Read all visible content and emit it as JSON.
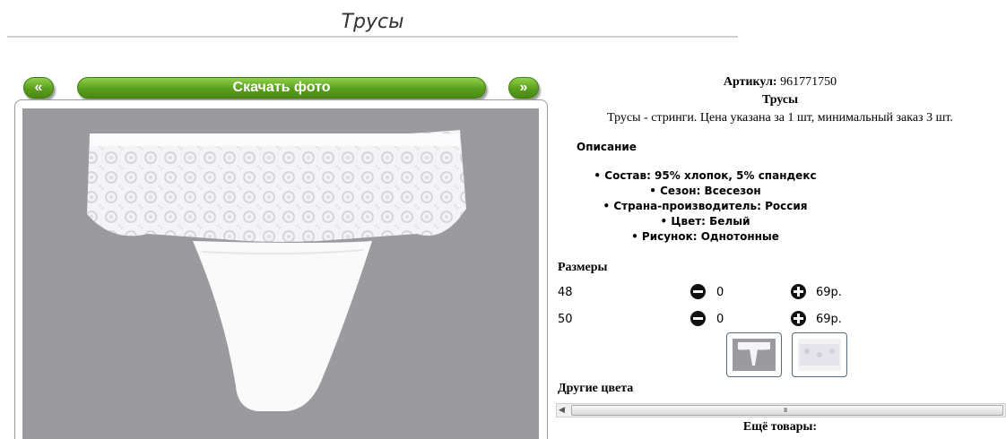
{
  "page": {
    "title": "Трусы"
  },
  "gallery": {
    "prev_label": "«",
    "next_label": "»",
    "download_label": "Скачать фото"
  },
  "product": {
    "article_label": "Артикул:",
    "article_value": "961771750",
    "name": "Трусы",
    "short_description": "Трусы - стринги. Цена указана за 1 шт, минимальный заказ 3 шт.",
    "description_heading": "Описание",
    "properties": [
      "Состав: 95% хлопок, 5% спандекс",
      "Сезон: Всесезон",
      "Страна-производитель: Россия",
      "Цвет: Белый",
      "Рисунок: Однотонные"
    ]
  },
  "sizes": {
    "heading": "Размеры",
    "rows": [
      {
        "size": "48",
        "qty": "0",
        "price": "69р."
      },
      {
        "size": "50",
        "qty": "0",
        "price": "69р."
      }
    ]
  },
  "other_colors": {
    "heading": "Другие цвета",
    "scroll_grip": "III"
  },
  "more_goods": {
    "heading": "Ещё товары:"
  },
  "colors": {
    "accent_green": "#5a9e1c",
    "photo_bg": "#9b9a9f"
  }
}
